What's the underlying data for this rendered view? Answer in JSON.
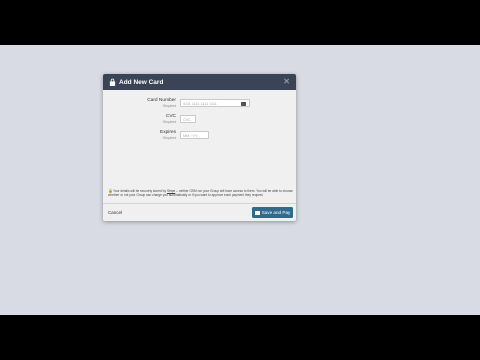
{
  "modal": {
    "title": "Add New Card",
    "fields": [
      {
        "label": "Card Number",
        "sublabel": "Required",
        "placeholder": "4111 1111 1111 1111"
      },
      {
        "label": "CVC",
        "sublabel": "Required",
        "placeholder": "CVC"
      },
      {
        "label": "Expires",
        "sublabel": "Required",
        "placeholder": "MM / YY"
      }
    ],
    "notice_prefix": "Your details will be securely stored by",
    "notice_link": "Stripe",
    "notice_suffix": "– neither OSM nor your Group will have access to them. You will be able to choose whether or not your Group can charge you automatically or if you want to approve each payment they request.",
    "cancel_label": "Cancel",
    "save_label": "Save and Pay"
  }
}
